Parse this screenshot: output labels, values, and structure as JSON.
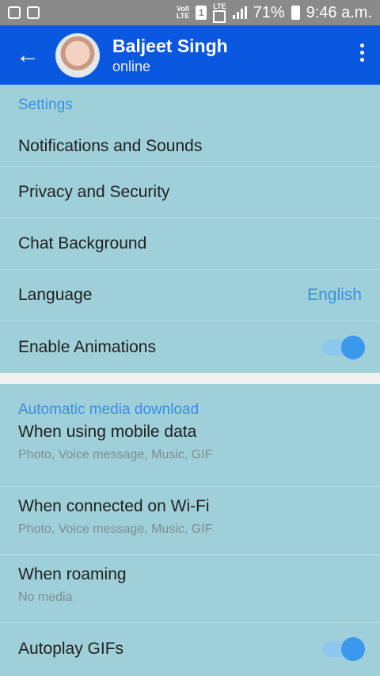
{
  "statusbar": {
    "network_top": "Vo0",
    "network_bottom": "LTE",
    "sim": "1",
    "lte": "LTE",
    "battery_percent": "71%",
    "time": "9:46 a.m."
  },
  "header": {
    "name": "Baljeet Singh",
    "status": "online",
    "back_icon": "←",
    "menu_icon": "more-vertical-icon"
  },
  "settings": {
    "title": "Settings",
    "items": [
      {
        "label": "Notifications and Sounds"
      },
      {
        "label": "Privacy and Security"
      },
      {
        "label": "Chat Background"
      },
      {
        "label": "Language",
        "value": "English"
      },
      {
        "label": "Enable Animations",
        "enabled": true
      }
    ]
  },
  "media": {
    "title": "Automatic media download",
    "items": [
      {
        "label": "When using mobile data",
        "sub": "Photo, Voice message, Music, GIF"
      },
      {
        "label": "When connected on Wi-Fi",
        "sub": "Photo, Voice message, Music, GIF"
      },
      {
        "label": "When roaming",
        "sub": "No media"
      }
    ],
    "autoplay": {
      "label": "Autoplay GIFs",
      "enabled": true
    }
  },
  "colors": {
    "accent": "#0a57e0",
    "link": "#3a8fe0",
    "background": "#9fd0d9"
  }
}
